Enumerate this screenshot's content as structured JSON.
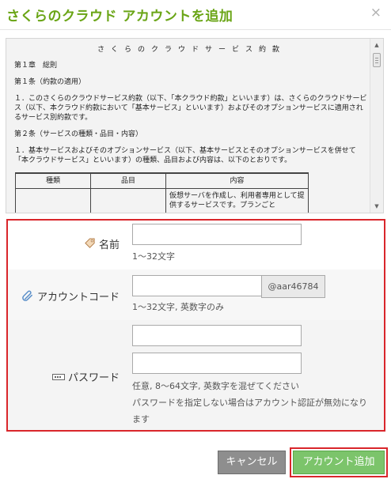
{
  "dialog": {
    "title": "さくらのクラウド アカウントを追加",
    "close_glyph": "×"
  },
  "terms": {
    "heading": "さくらのクラウドサービス約款",
    "chapter": "第１章　総則",
    "article1_title": "第１条（約款の適用）",
    "article1_body": "１．このさくらのクラウドサービス約款（以下、「本クラウド約款」といいます）は、さくらのクラウドサービス（以下、本クラウド約款において「基本サービス」といいます）およびそのオプションサービスに適用されるサービス別約款です。",
    "article2_title": "第２条（サービスの種類・品目・内容）",
    "article2_body": "１．基本サービスおよびそのオプションサービス（以下、基本サービスとそのオプションサービスを併せて「本クラウドサービス」といいます）の種類、品目および内容は、以下のとおりです。",
    "table": {
      "headers": [
        "種類",
        "品目",
        "内容"
      ],
      "first_row_content": "仮想サーバを作成し、利用者専用として提供するサービスです。プランごと"
    }
  },
  "form": {
    "name": {
      "label": "名前",
      "icon": "tag-icon",
      "value": "",
      "hint": "1〜32文字"
    },
    "account_code": {
      "label": "アカウントコード",
      "icon": "paperclip-icon",
      "value": "",
      "suffix": "@aar46784",
      "hint": "1〜32文字, 英数字のみ"
    },
    "password": {
      "label": "パスワード",
      "icon": "password-icon",
      "value": "",
      "confirm_value": "",
      "hint1": "任意, 8〜64文字, 英数字を混ぜてください",
      "hint2": "パスワードを指定しない場合はアカウント認証が無効になります"
    }
  },
  "buttons": {
    "cancel": "キャンセル",
    "add": "アカウント追加"
  },
  "colors": {
    "title": "#6aa516",
    "highlight_border": "#d9262b",
    "add_button": "#7cc46b",
    "cancel_button": "#8e8e8e"
  }
}
